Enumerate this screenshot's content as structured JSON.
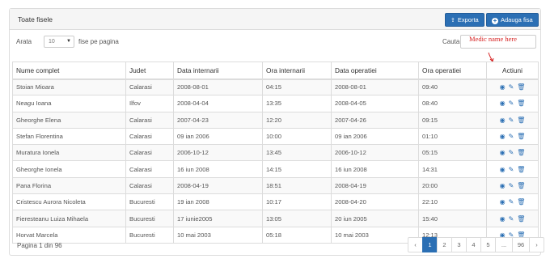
{
  "panel": {
    "title": "Toate fisele",
    "export_label": "Exporta",
    "add_label": "Adauga fisa"
  },
  "toolbar": {
    "show_label": "Arata",
    "page_size_value": "10",
    "per_page_label": "fise pe pagina",
    "search_label": "Cauta:",
    "search_value": ""
  },
  "annotation": {
    "text": "Medic name here",
    "color": "#d62020"
  },
  "table": {
    "headers": [
      "Nume complet",
      "Judet",
      "Data internarii",
      "Ora internarii",
      "Data operatiei",
      "Ora operatiei",
      "Actiuni"
    ],
    "rows": [
      [
        "Stoian Mioara",
        "Calarasi",
        "2008-08-01",
        "04:15",
        "2008-08-01",
        "09:40"
      ],
      [
        "Neagu Ioana",
        "Ilfov",
        "2008-04-04",
        "13:35",
        "2008-04-05",
        "08:40"
      ],
      [
        "Gheorghe Elena",
        "Calarasi",
        "2007-04-23",
        "12:20",
        "2007-04-26",
        "09:15"
      ],
      [
        "Stefan Florentina",
        "Calarasi",
        "09 ian 2006",
        "10:00",
        "09 ian 2006",
        "01:10"
      ],
      [
        "Muratura Ionela",
        "Calarasi",
        "2006-10-12",
        "13:45",
        "2006-10-12",
        "05:15"
      ],
      [
        "Gheorghe Ionela",
        "Calarasi",
        "16 iun 2008",
        "14:15",
        "16 iun 2008",
        "14:31"
      ],
      [
        "Pana Florina",
        "Calarasi",
        "2008-04-19",
        "18:51",
        "2008-04-19",
        "20:00"
      ],
      [
        "Cristescu Aurora Nicoleta",
        "Bucuresti",
        "19 ian 2008",
        "10:17",
        "2008-04-20",
        "22:10"
      ],
      [
        "Fieresteanu Luiza Mihaela",
        "Bucuresti",
        "17 iunie2005",
        "13:05",
        "20 iun 2005",
        "15:40"
      ],
      [
        "Horvat Marcela",
        "Bucuresti",
        "10 mai 2003",
        "05:18",
        "10 mai 2003",
        "12:13"
      ]
    ],
    "action_icons": [
      "eye-icon",
      "edit-icon",
      "trash-icon"
    ]
  },
  "footer": {
    "page_info": "Pagina 1 din 96",
    "pages": [
      "‹",
      "1",
      "2",
      "3",
      "4",
      "5",
      "...",
      "96",
      "›"
    ],
    "active_page": "1"
  },
  "colors": {
    "accent": "#2b6fb4",
    "border": "#dcdcdc",
    "header_bg": "#f5f5f5"
  }
}
